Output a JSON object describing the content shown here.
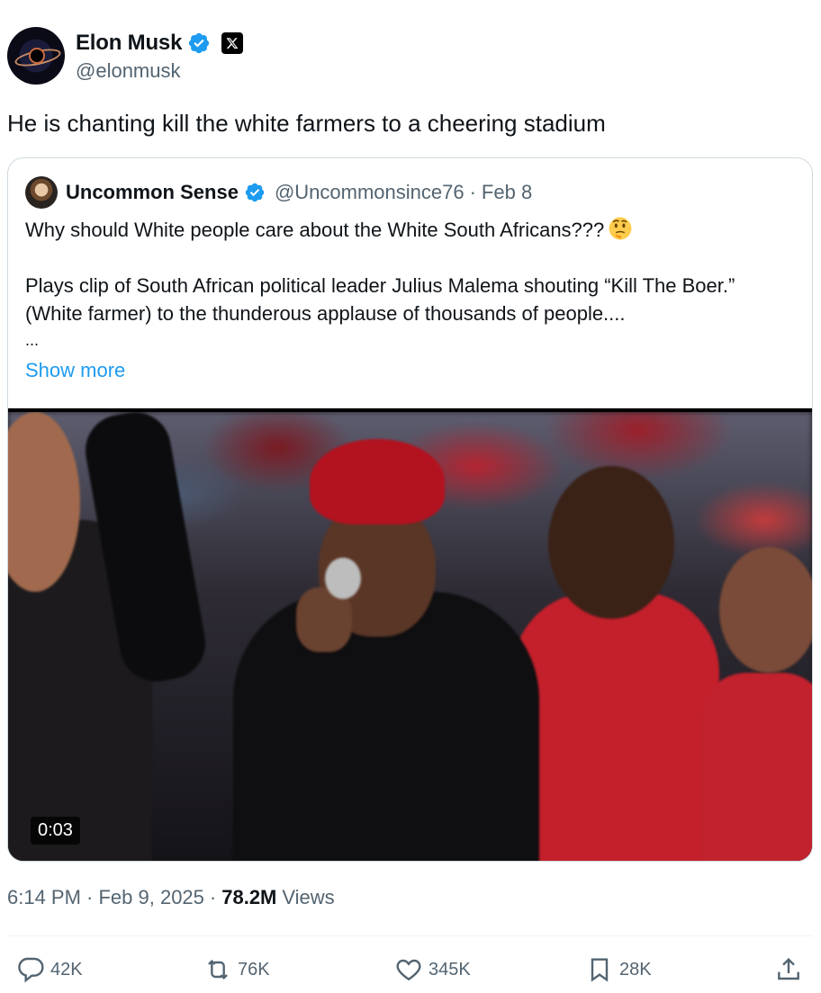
{
  "author": {
    "display_name": "Elon Musk",
    "handle": "@elonmusk",
    "icons": [
      "verified-badge-icon",
      "x-affiliation-icon"
    ]
  },
  "tweet": {
    "text": "He is chanting kill the white farmers to a cheering stadium",
    "timestamp": "6:14 PM · Feb 9, 2025",
    "views_count": "78.2M",
    "views_label": "Views"
  },
  "quoted": {
    "display_name": "Uncommon Sense",
    "handle": "@Uncommonsince76",
    "date": "Feb 8",
    "separator": "·",
    "line1": "Why should White people care about the White South Africans???",
    "line2": "Plays clip of South African political leader Julius Malema shouting “Kill The Boer.” (White farmer) to the thunderous applause of thousands of people....",
    "line3": "...",
    "show_more": "Show more",
    "emoji": "thinking-face",
    "video": {
      "timestamp": "0:03"
    }
  },
  "actions": {
    "reply": "42K",
    "repost": "76K",
    "like": "345K",
    "bookmark": "28K"
  },
  "colors": {
    "link": "#1d9bf0",
    "secondary_text": "#536471",
    "primary_text": "#0f1419",
    "border": "#cfd9de"
  }
}
